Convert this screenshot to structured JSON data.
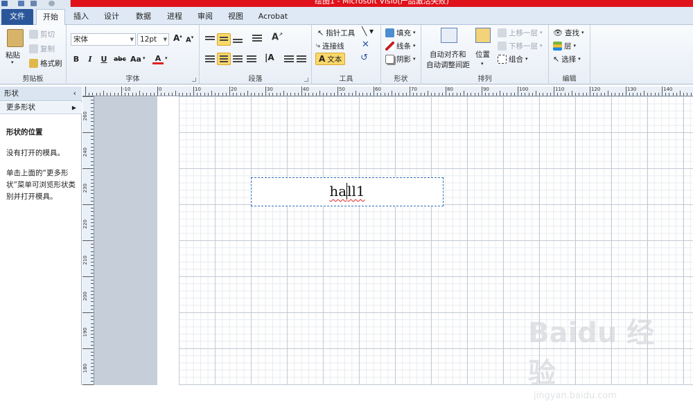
{
  "window": {
    "title": "绘图1 - Microsoft Visio(产品激活失败)"
  },
  "tabs": [
    "文件",
    "开始",
    "插入",
    "设计",
    "数据",
    "进程",
    "审阅",
    "视图",
    "Acrobat"
  ],
  "clipboard": {
    "paste": "粘贴",
    "cut": "剪切",
    "copy": "复制",
    "format_painter": "格式刷",
    "label": "剪贴板"
  },
  "font": {
    "name": "宋体",
    "size": "12pt",
    "bold": "B",
    "italic": "I",
    "underline": "U",
    "strike": "abc",
    "case": "Aa",
    "color_a": "A",
    "label": "字体"
  },
  "paragraph": {
    "label": "段落"
  },
  "tools": {
    "pointer": "指针工具",
    "connector": "连接线",
    "text": "文本",
    "label": "工具"
  },
  "shape": {
    "fill": "填充",
    "line": "线条",
    "shadow": "阴影",
    "label": "形状"
  },
  "arrange": {
    "auto_align": "自动对齐和",
    "auto_spacing": "自动调整间距",
    "position": "位置",
    "bring_forward": "上移一层",
    "send_backward": "下移一层",
    "group": "组合",
    "label": "排列"
  },
  "editing": {
    "find": "查找",
    "layers": "层",
    "select": "选择",
    "label": "编辑"
  },
  "shapes_panel": {
    "title": "形状",
    "more_shapes": "更多形状",
    "heading": "形状的位置",
    "no_stencils": "没有打开的模具。",
    "hint": "单击上面的“更多形状”菜单可浏览形状类别并打开模具。"
  },
  "ruler": {
    "h_ticks": [
      "-10",
      "0",
      "10",
      "20",
      "30",
      "40",
      "50",
      "60",
      "70",
      "80",
      "90",
      "100",
      "110",
      "120",
      "130",
      "140"
    ],
    "v_ticks": [
      "260",
      "240",
      "230",
      "220",
      "210",
      "200",
      "190",
      "180"
    ]
  },
  "canvas": {
    "text_prefix": "ha",
    "text_rest": "ll1"
  },
  "watermark": {
    "text": "Baidu 经验",
    "sub": "jingyan.baidu.com"
  }
}
